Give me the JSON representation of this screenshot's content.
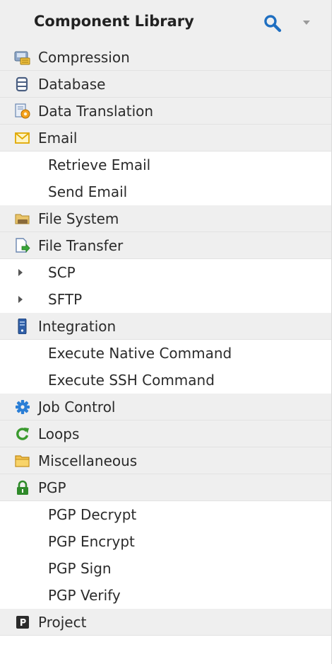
{
  "header": {
    "title": "Component Library"
  },
  "categories": {
    "compression": "Compression",
    "database": "Database",
    "data_translation": "Data Translation",
    "email": "Email",
    "file_system": "File System",
    "file_transfer": "File Transfer",
    "integration": "Integration",
    "job_control": "Job Control",
    "loops": "Loops",
    "miscellaneous": "Miscellaneous",
    "pgp": "PGP",
    "project": "Project"
  },
  "email_items": [
    "Retrieve Email",
    "Send Email"
  ],
  "file_transfer_groups": [
    "SCP",
    "SFTP"
  ],
  "integration_items": [
    "Execute Native Command",
    "Execute SSH Command"
  ],
  "pgp_items": [
    "PGP Decrypt",
    "PGP Encrypt",
    "PGP Sign",
    "PGP Verify"
  ],
  "icons": {
    "search": "search-icon",
    "collapse": "chevron-down-icon",
    "compression": "compression-icon",
    "database": "database-icon",
    "data_translation": "data-translation-icon",
    "email": "envelope-icon",
    "file_system": "folder-drive-icon",
    "file_transfer": "file-transfer-icon",
    "integration": "server-icon",
    "job_control": "gear-icon",
    "loops": "loop-arrow-icon",
    "miscellaneous": "folder-icon",
    "pgp": "lock-icon",
    "project": "project-icon"
  },
  "colors": {
    "header_bg": "#efefef",
    "category_bg": "#efefef",
    "search_icon": "#1f6fc1",
    "loops_icon": "#3a9a2e",
    "pgp_icon": "#2f8a2a",
    "job_control_icon": "#2a7ed6"
  }
}
